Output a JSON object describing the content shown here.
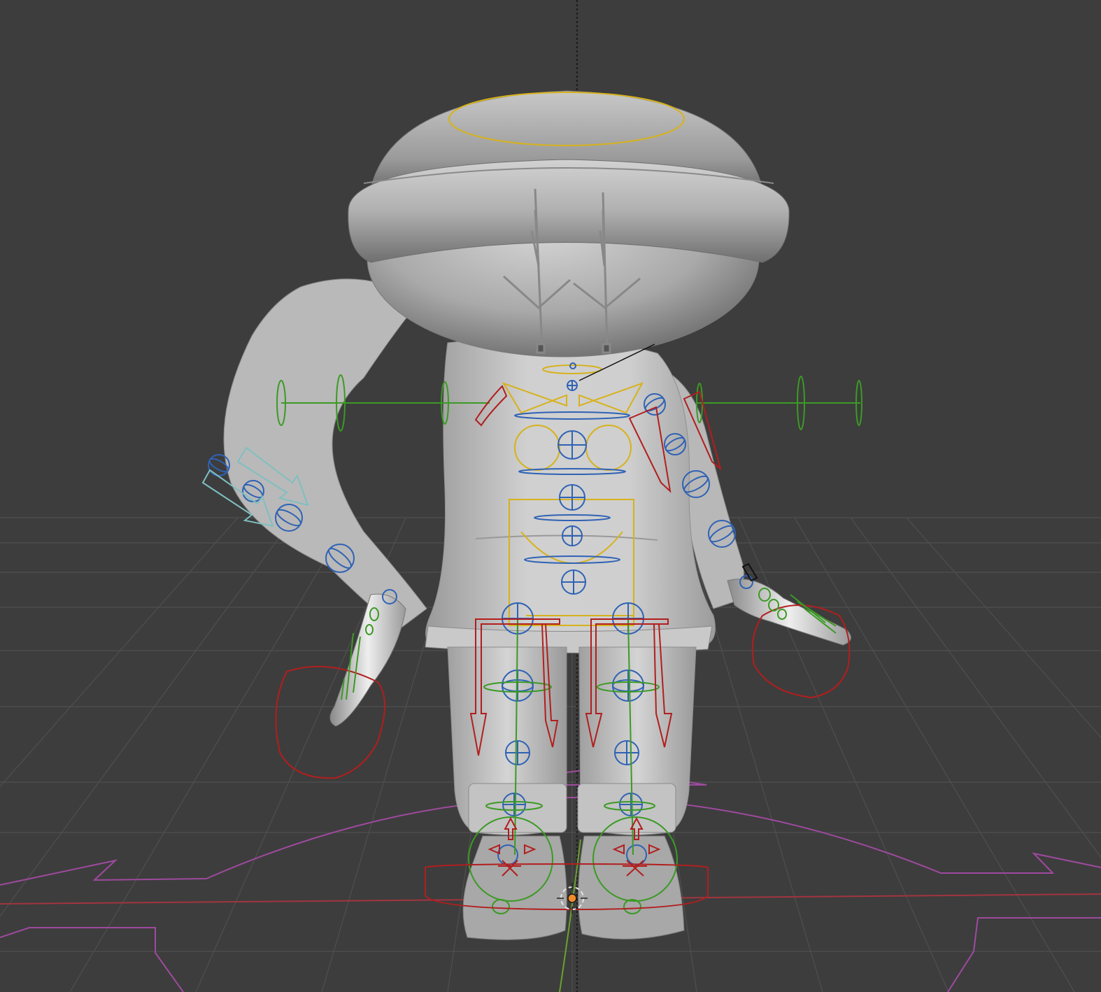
{
  "viewport": {
    "background": "#3d3d3d",
    "grid_color": "#4f4f4f",
    "x_axis_color": "#a2343f",
    "z_axis_color": "#6aa22e",
    "origin_color": "#f28c28",
    "mesh_color": "#c4c4c4"
  },
  "rig_colors": {
    "fk_controls": "#2f62b5",
    "torso_controls": "#d7b21c",
    "ik_controls": "#b21e1e",
    "bend_controls": "#3b9a24",
    "root_control": "#9e4a9e",
    "tweak_controls": "#7fbfbf"
  },
  "scene": {
    "object": "character-mesh",
    "armature": "armature-rig",
    "view": "front-perspective"
  }
}
